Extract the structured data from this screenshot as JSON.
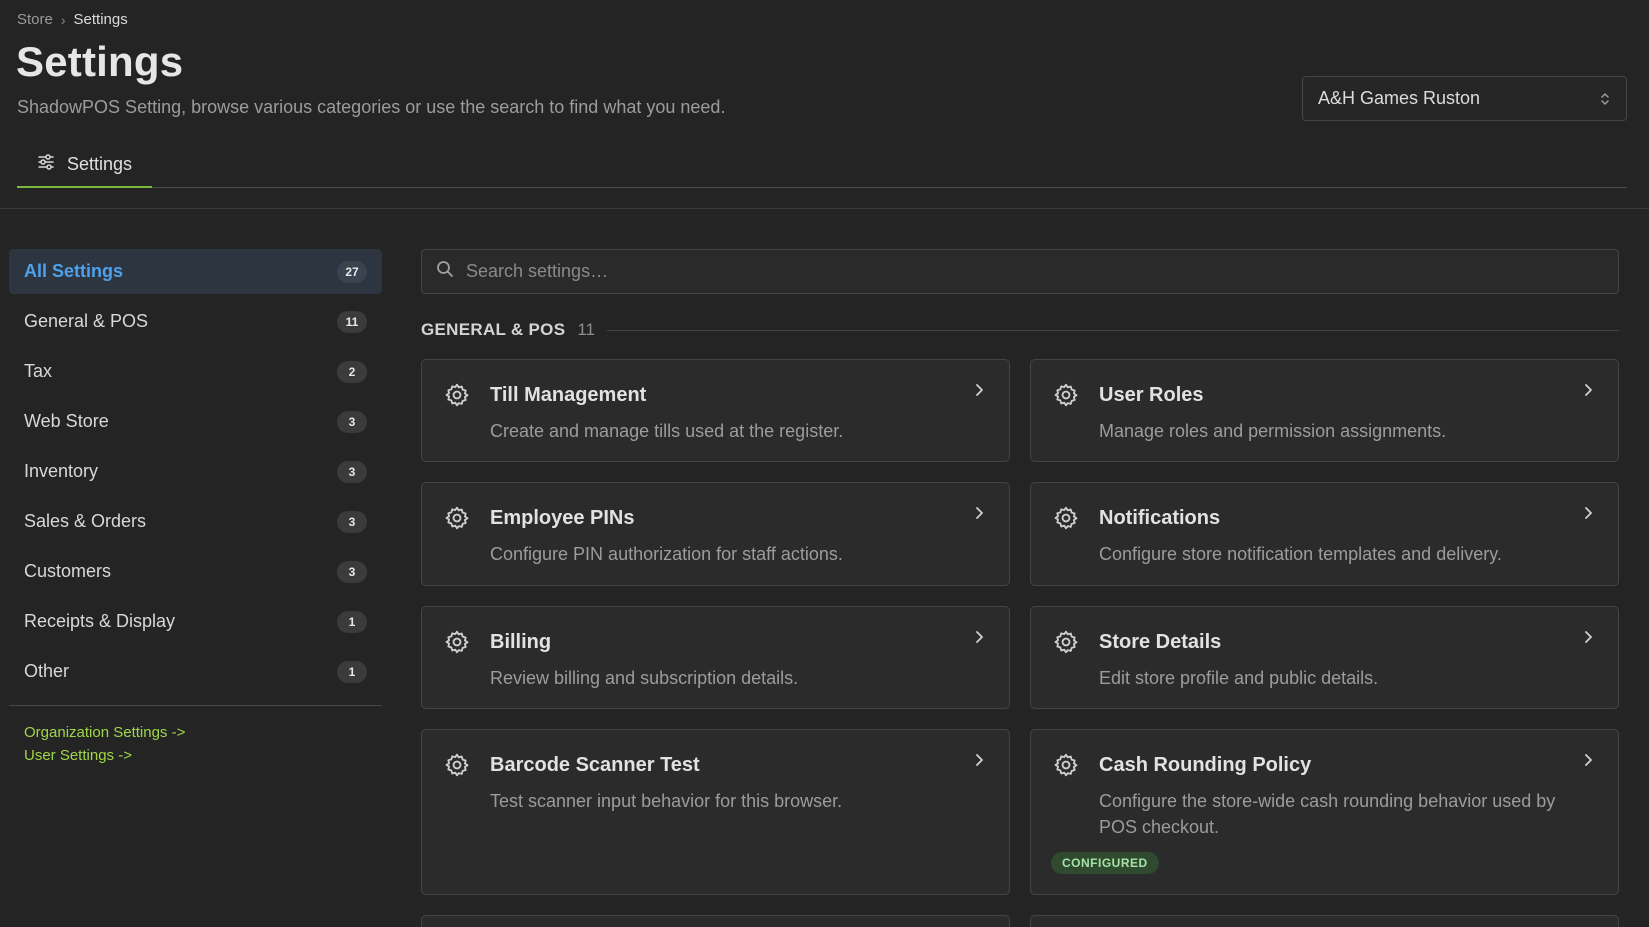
{
  "breadcrumb": {
    "root": "Store",
    "separator": "›",
    "current": "Settings"
  },
  "header": {
    "title": "Settings",
    "subtitle": "ShadowPOS Setting, browse various categories or use the search to find what you need."
  },
  "store_select": {
    "value": "A&H Games Ruston"
  },
  "tabs": [
    {
      "label": "Settings",
      "icon": "sliders-icon",
      "active": true
    }
  ],
  "sidebar": {
    "items": [
      {
        "label": "All Settings",
        "count": "27",
        "active": true
      },
      {
        "label": "General & POS",
        "count": "11"
      },
      {
        "label": "Tax",
        "count": "2"
      },
      {
        "label": "Web Store",
        "count": "3"
      },
      {
        "label": "Inventory",
        "count": "3"
      },
      {
        "label": "Sales & Orders",
        "count": "3"
      },
      {
        "label": "Customers",
        "count": "3"
      },
      {
        "label": "Receipts & Display",
        "count": "1"
      },
      {
        "label": "Other",
        "count": "1"
      }
    ],
    "links": [
      {
        "label": "Organization Settings ->"
      },
      {
        "label": "User Settings ->"
      }
    ]
  },
  "search": {
    "placeholder": "Search settings…"
  },
  "section": {
    "title": "GENERAL & POS",
    "count": "11"
  },
  "cards": [
    {
      "title": "Till Management",
      "description": "Create and manage tills used at the register."
    },
    {
      "title": "User Roles",
      "description": "Manage roles and permission assignments."
    },
    {
      "title": "Employee PINs",
      "description": "Configure PIN authorization for staff actions."
    },
    {
      "title": "Notifications",
      "description": "Configure store notification templates and delivery."
    },
    {
      "title": "Billing",
      "description": "Review billing and subscription details."
    },
    {
      "title": "Store Details",
      "description": "Edit store profile and public details."
    },
    {
      "title": "Barcode Scanner Test",
      "description": "Test scanner input behavior for this browser."
    },
    {
      "title": "Cash Rounding Policy",
      "description": "Configure the store-wide cash rounding behavior used by POS checkout.",
      "badge": "CONFIGURED"
    }
  ],
  "colors": {
    "accent_green": "#7ab93b",
    "active_blue": "#4ea1ea",
    "link_green": "#9fd64a",
    "badge_bg": "#2f4a2f"
  }
}
